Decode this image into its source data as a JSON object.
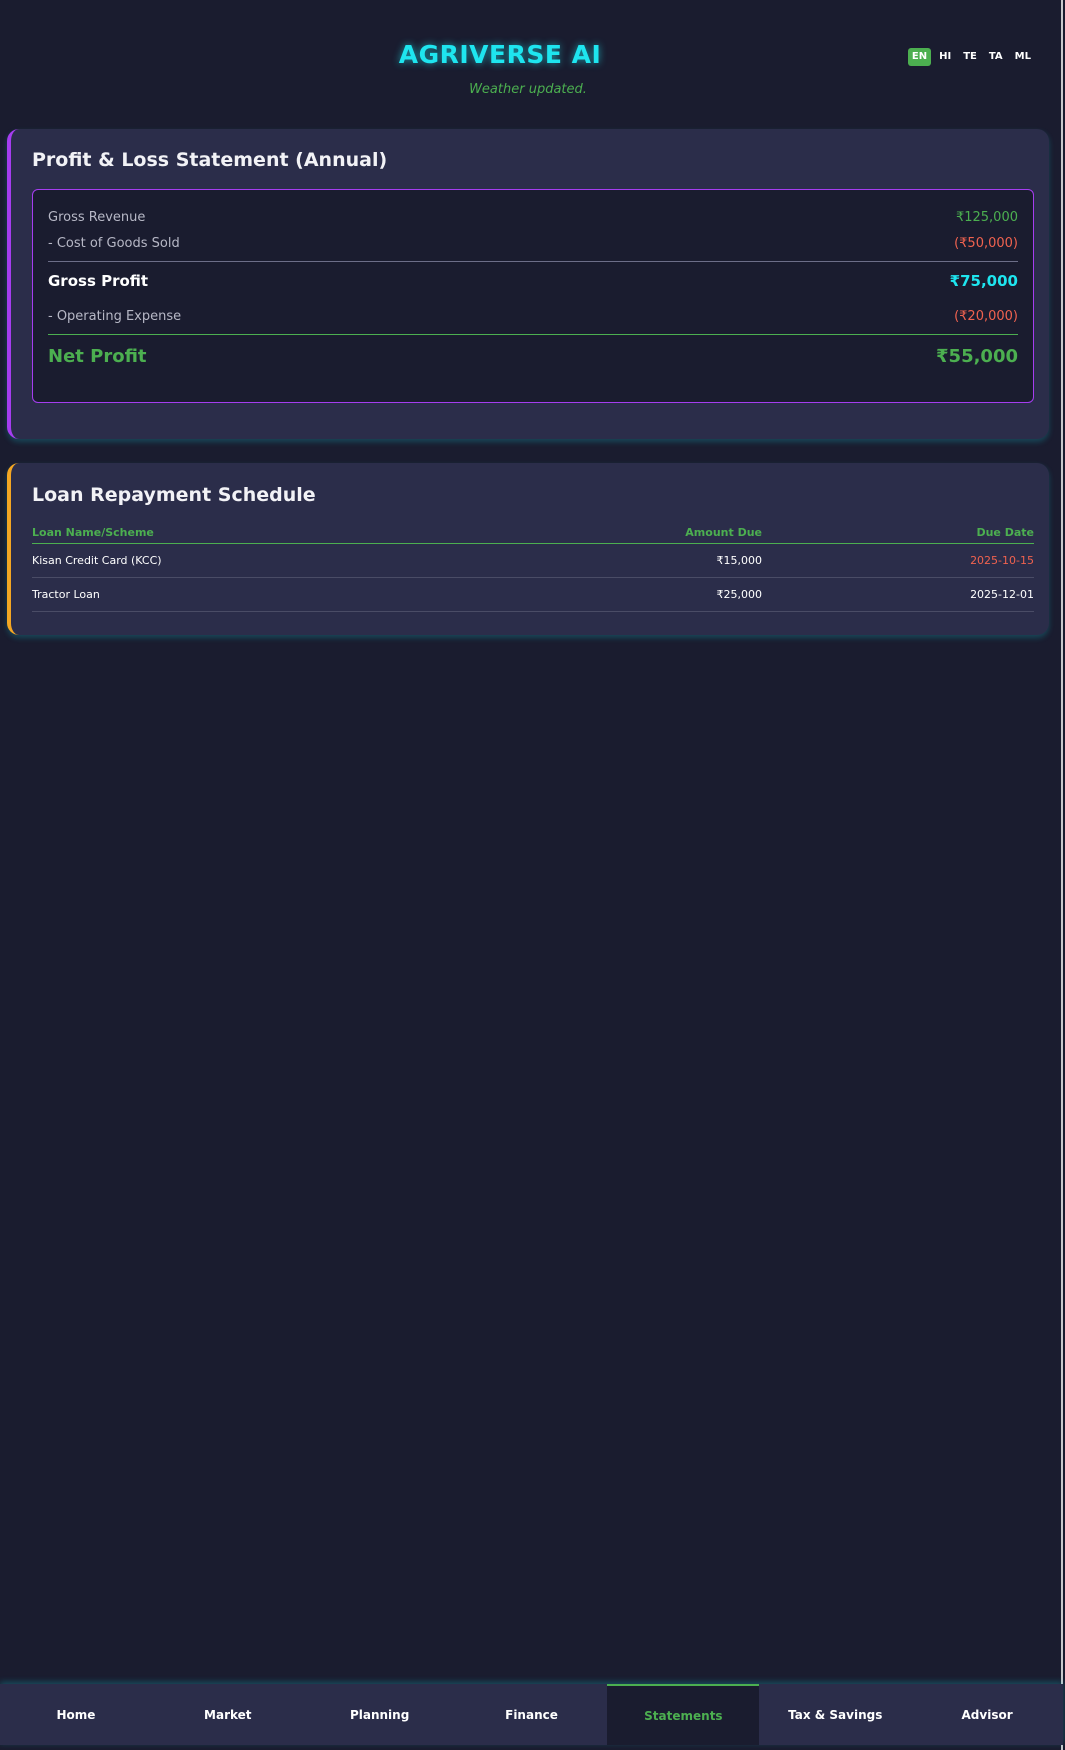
{
  "app": {
    "title": "AGRIVERSE AI",
    "status_message": "Weather updated."
  },
  "languages": [
    {
      "code": "EN",
      "active": true
    },
    {
      "code": "HI",
      "active": false
    },
    {
      "code": "TE",
      "active": false
    },
    {
      "code": "TA",
      "active": false
    },
    {
      "code": "ML",
      "active": false
    }
  ],
  "pl_statement": {
    "title": "Profit & Loss Statement (Annual)",
    "gross_revenue": {
      "label": "Gross Revenue",
      "value": "₹125,000"
    },
    "cogs": {
      "label": "- Cost of Goods Sold",
      "value": "(₹50,000)"
    },
    "gross_profit": {
      "label": "Gross Profit",
      "value": "₹75,000"
    },
    "operating_expense": {
      "label": "- Operating Expense",
      "value": "(₹20,000)"
    },
    "net_profit": {
      "label": "Net Profit",
      "value": "₹55,000"
    }
  },
  "loan_schedule": {
    "title": "Loan Repayment Schedule",
    "columns": [
      "Loan Name/Scheme",
      "Amount Due",
      "Due Date"
    ],
    "rows": [
      {
        "name": "Kisan Credit Card (KCC)",
        "amount": "₹15,000",
        "due_date": "2025-10-15"
      },
      {
        "name": "Tractor Loan",
        "amount": "₹25,000",
        "due_date": "2025-12-01"
      }
    ]
  },
  "nav": {
    "items": [
      "Home",
      "Market",
      "Planning",
      "Finance",
      "Statements",
      "Tax & Savings",
      "Advisor"
    ],
    "active": "Statements"
  },
  "colors": {
    "background": "#1a1c2f",
    "card": "#2b2d4a",
    "accent_cyan": "#1ee5ef",
    "accent_green": "#4caf50",
    "accent_red": "#f0624f",
    "accent_purple": "#a53df0",
    "accent_orange": "#f4a623"
  }
}
